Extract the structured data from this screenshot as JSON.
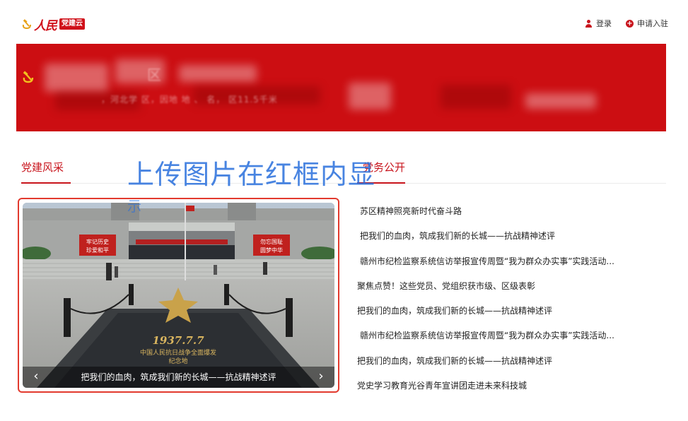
{
  "header": {
    "logo_text": "人民",
    "logo_badge": "党建云",
    "login_label": "登录",
    "apply_label": "申请入驻",
    "icons": {
      "login": "user-icon",
      "apply": "plus-circle-icon",
      "logo": "hammer-sickle-icon"
    }
  },
  "banner": {
    "title_blurred": "区",
    "subtitle_blurred": "，河北学  区，因地  地  、  名，  区11.5千米",
    "bg_color": "#cc0e12"
  },
  "tabs": {
    "left": "党建风采",
    "right": "党务公开"
  },
  "overlay": {
    "line1": "上传图片在红框内显",
    "line2": "示"
  },
  "carousel": {
    "caption": "把我们的血肉，筑成我们新的长城——抗战精神述评",
    "prev_icon": "chevron-left-icon",
    "next_icon": "chevron-right-icon",
    "sign_left": [
      "牢记历史",
      "珍爱和平"
    ],
    "sign_right": [
      "勿忘国耻",
      "圆梦中华"
    ],
    "monument_date": "1937.7.7",
    "monument_line1": "中国人民抗日战争全面爆发",
    "monument_line2": "纪念地",
    "frame_color": "#e23a2e"
  },
  "news": [
    {
      "text": "苏区精神照亮新时代奋斗路",
      "indent": true
    },
    {
      "text": "把我们的血肉，筑成我们新的长城——抗战精神述评",
      "indent": true
    },
    {
      "text": "赣州市纪检监察系统信访举报宣传周暨“我为群众办实事”实践活动...",
      "indent": true
    },
    {
      "text": "聚焦点赞！这些党员、党组织获市级、区级表彰",
      "indent": false
    },
    {
      "text": "把我们的血肉，筑成我们新的长城——抗战精神述评",
      "indent": false
    },
    {
      "text": "赣州市纪检监察系统信访举报宣传周暨“我为群众办实事”实践活动...",
      "indent": true
    },
    {
      "text": "把我们的血肉，筑成我们新的长城——抗战精神述评",
      "indent": false
    },
    {
      "text": "党史学习教育光谷青年宣讲团走进未来科技城",
      "indent": false
    }
  ],
  "colors": {
    "accent": "#c8141c",
    "text": "#222222"
  }
}
